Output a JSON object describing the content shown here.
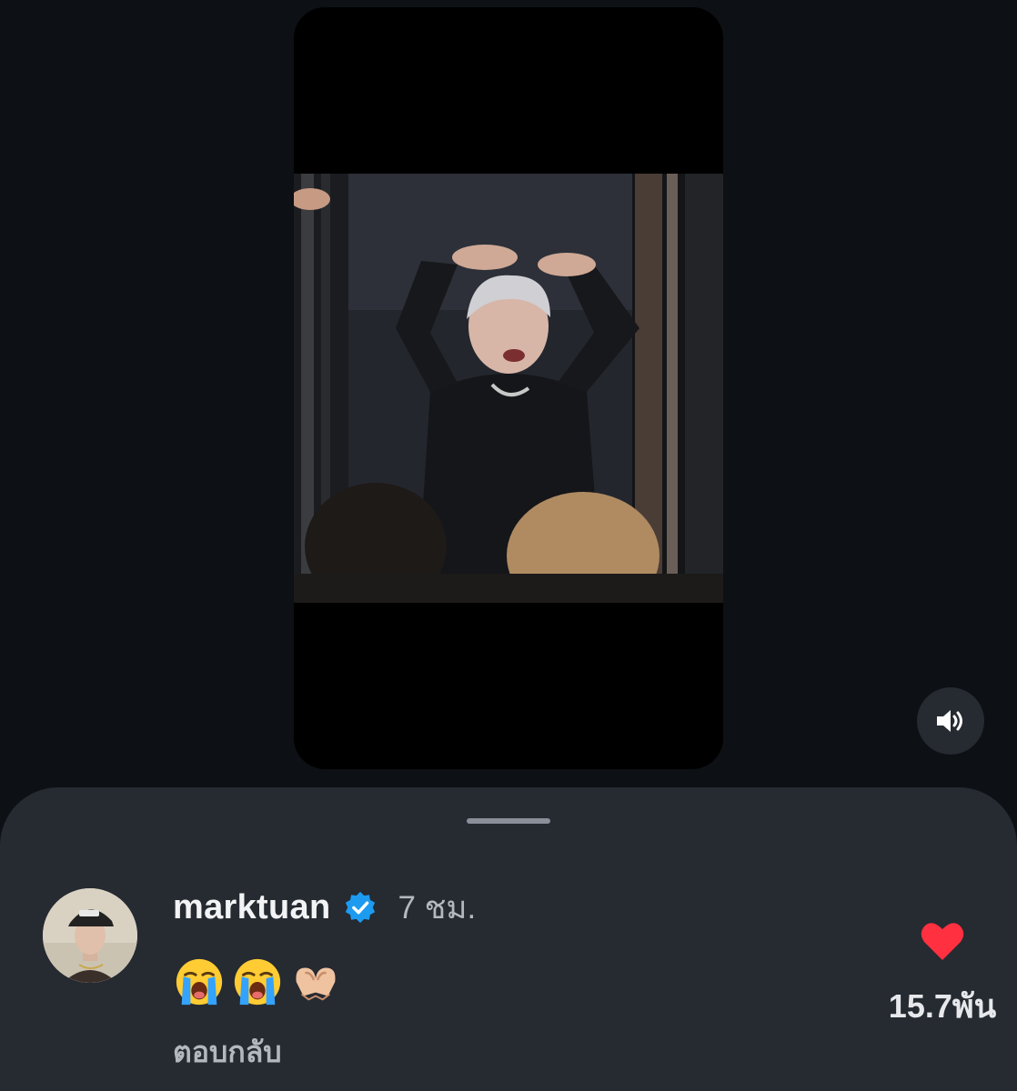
{
  "reel": {
    "sound_state": "muted-toggle-volume"
  },
  "comment": {
    "username": "marktuan",
    "verified": true,
    "timestamp": "7 ชม.",
    "emojis": [
      "loudly-crying-face",
      "loudly-crying-face",
      "heart-hands"
    ],
    "reply_label": "ตอบกลับ",
    "like_count": "15.7พัน",
    "liked": true
  },
  "colors": {
    "background": "#0d1014",
    "sheet": "#262a31",
    "like_red": "#ff3040",
    "verified_blue": "#1d9bf0",
    "primary_text": "#f2f3f5",
    "secondary_text": "#b3b8c0"
  }
}
